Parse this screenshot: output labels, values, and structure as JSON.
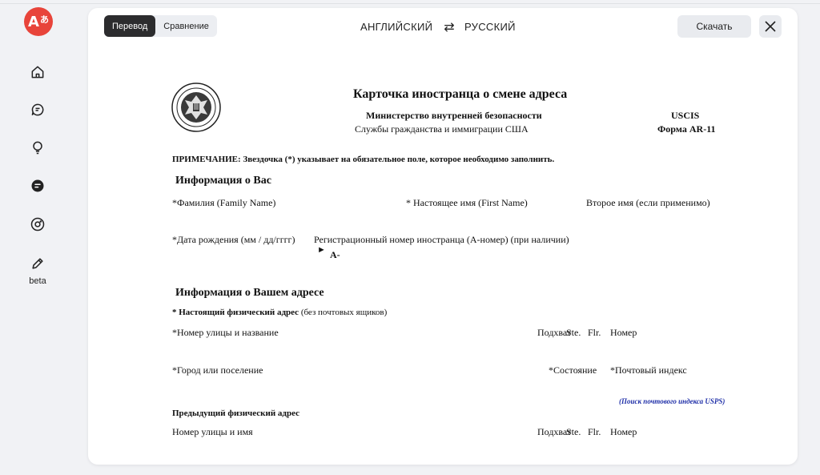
{
  "sidebar": {
    "logo_text": "A",
    "logo_sub": "あ",
    "items": [
      {
        "icon": "home-icon"
      },
      {
        "icon": "chat-icon"
      },
      {
        "icon": "lightbulb-icon"
      },
      {
        "icon": "document-icon"
      },
      {
        "icon": "camera-icon"
      },
      {
        "icon": "pencil-icon",
        "label": "beta"
      }
    ],
    "accent": "#e8443a"
  },
  "toolbar": {
    "tabs": [
      {
        "label": "Перевод",
        "active": true
      },
      {
        "label": "Сравнение",
        "active": false
      }
    ],
    "source_lang": "АНГЛИЙСКИЙ",
    "target_lang": "РУССКИЙ",
    "swap_glyph": "⇄",
    "download_label": "Скачать",
    "close_glyph": "✕"
  },
  "document": {
    "title": "Карточка иностранца о смене адреса",
    "agency": "Министерство внутренней безопасности",
    "service": "Службы гражданства и иммиграции США",
    "org_code": "USCIS",
    "form_number": "Форма AR-11",
    "note": "ПРИМЕЧАНИЕ: Звездочка (*) указывает на обязательное поле, которое необходимо заполнить.",
    "section_about": "Информация о Вас",
    "family_name": "*Фамилия (Family Name)",
    "first_name": "* Настоящее имя (First Name)",
    "middle_name": "Второе имя (если применимо)",
    "dob": "*Дата рождения (мм / дд/гггг)",
    "a_number": "Регистрационный номер иностранца (А-номер) (при наличии)",
    "a_arrow": "►",
    "a_prefix": "A-",
    "section_address": "Информация о Вашем адресе",
    "current_star": "* ",
    "current_bold": "Настоящий физический адрес",
    "current_rest": " (без почтовых ящиков)",
    "street1": "*Номер улицы и название",
    "apt1": "Подхват",
    "ste1": "Ste.",
    "flr1": "Flr.",
    "num1": "Номер",
    "city": "*Город или поселение",
    "state": "*Состояние",
    "zip": "*Почтовый индекс",
    "usps_link": "(Поиск почтового индекса USPS)",
    "previous": "Предыдущий физический адрес",
    "street2": "Номер улицы и имя",
    "apt2": "Подхват",
    "ste2": "Ste.",
    "flr2": "Flr.",
    "num2": "Номер"
  }
}
